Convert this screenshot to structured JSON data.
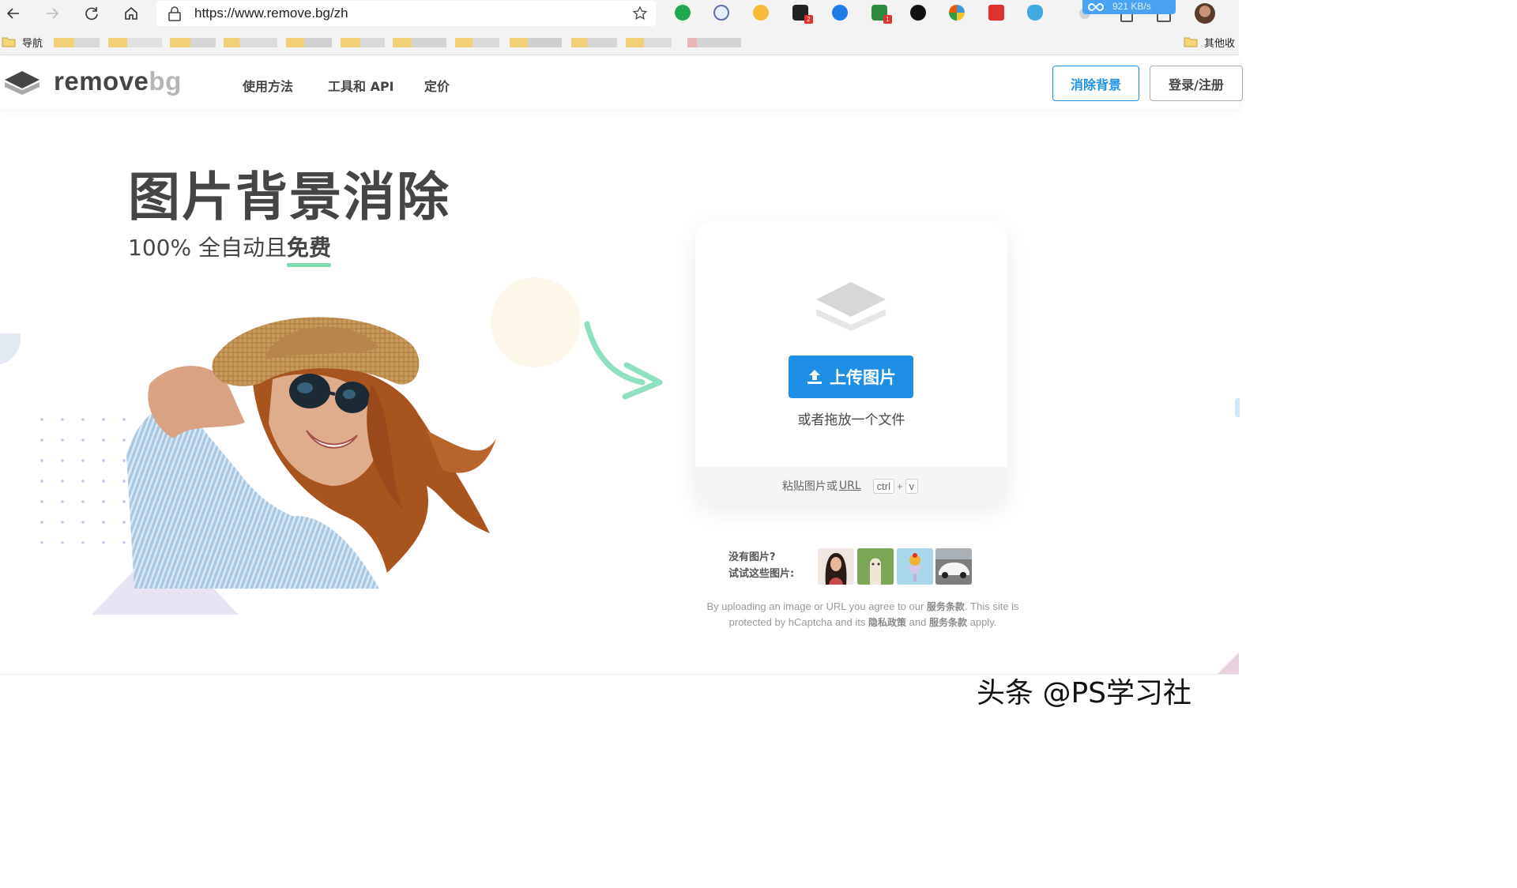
{
  "browser": {
    "url": "https://www.remove.bg/zh",
    "download_speed": "921 KB/s",
    "extension_badges": [
      "2",
      "1"
    ]
  },
  "bookmarks": {
    "nav_folder": "导航",
    "other_folder": "其他收"
  },
  "header": {
    "logo_remove": "remove",
    "logo_bg": "bg",
    "nav": [
      "使用方法",
      "工具和 API",
      "定价"
    ],
    "remove_bg_button": "消除背景",
    "login_button": "登录/注册"
  },
  "hero": {
    "title": "图片背景消除",
    "subtitle_prefix": "100% 全自动且",
    "subtitle_highlight": "免费"
  },
  "upload": {
    "button": "上传图片",
    "drop_text": "或者拖放一个文件",
    "paste_text": "粘贴图片或",
    "paste_url": "URL",
    "key_ctrl": "ctrl",
    "key_plus": "+",
    "key_v": "v"
  },
  "samples": {
    "line1": "没有图片?",
    "line2": "试试这些图片:"
  },
  "legal": {
    "part1": "By uploading an image or URL you agree to our",
    "terms1": "服务条款",
    "part2": ". This site is protected by hCaptcha and its",
    "privacy": "隐私政策",
    "part3": "and",
    "terms2": "服务条款",
    "part4": "apply."
  },
  "watermark": "头条 @PS学习社",
  "colors": {
    "accent_blue": "#1f8fe5",
    "underline_green": "#7fdcb0",
    "text_dark": "#454545"
  }
}
